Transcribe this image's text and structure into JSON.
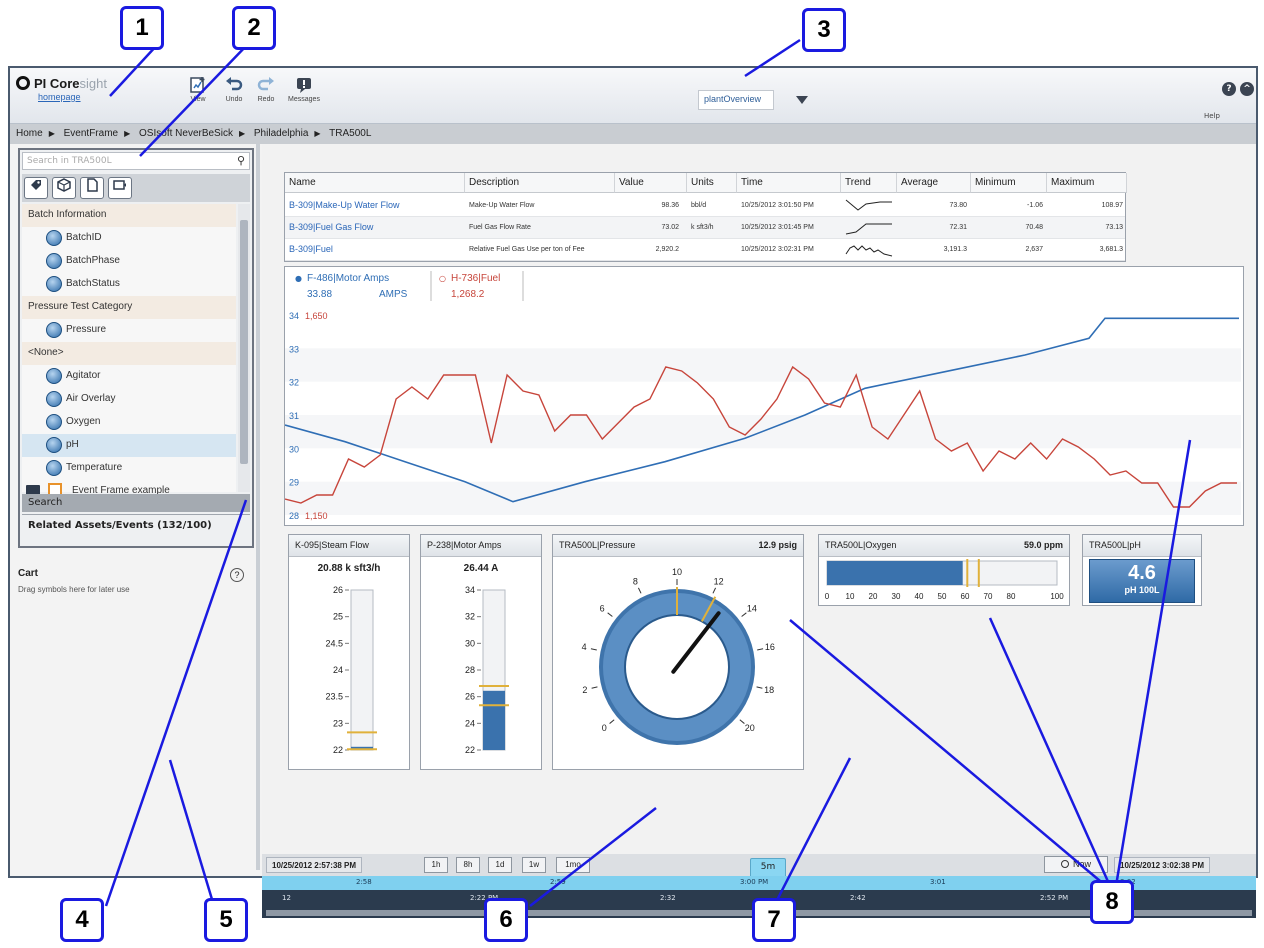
{
  "header": {
    "logo_main": "PI Core",
    "logo_sub": "sight",
    "homepage_link": "homepage",
    "toolbar": [
      {
        "label": "View",
        "icon": "new-display-icon"
      },
      {
        "label": "Undo",
        "icon": "undo-icon"
      },
      {
        "label": "Redo",
        "icon": "redo-icon"
      },
      {
        "label": "Messages",
        "icon": "messages-icon"
      }
    ],
    "display_name": "plantOverview",
    "help_label": "Help",
    "help_glyph": "?",
    "collapse_glyph": "^"
  },
  "breadcrumb": [
    "Home",
    "EventFrame",
    "OSIsoft NeverBeSick",
    "Philadelphia",
    "TRA500L"
  ],
  "search": {
    "placeholder": "Search in TRA500L"
  },
  "tree": {
    "categories": [
      {
        "label": "Batch Information",
        "items": [
          "BatchID",
          "BatchPhase",
          "BatchStatus"
        ]
      },
      {
        "label": "Pressure Test Category",
        "items": [
          "Pressure"
        ]
      },
      {
        "label": "<None>",
        "items": [
          "Agitator",
          "Air Overlay",
          "Oxygen",
          "pH",
          "Temperature"
        ]
      }
    ],
    "selected": "pH",
    "event_frame_label": "Event Frame example"
  },
  "search_section_label": "Search",
  "related_label": "Related Assets/Events (132/100)",
  "cart": {
    "title": "Cart",
    "description": "Drag symbols here for later use",
    "help_glyph": "?"
  },
  "table": {
    "headers": [
      "Name",
      "Description",
      "Value",
      "Units",
      "Time",
      "Trend",
      "Average",
      "Minimum",
      "Maximum"
    ],
    "rows": [
      {
        "name": "B-309|Make-Up Water Flow",
        "description": "Make-Up Water Flow",
        "value": "98.36",
        "units": "bbl/d",
        "time": "10/25/2012 3:01:50 PM",
        "average": "73.80",
        "minimum": "-1.06",
        "maximum": "108.97"
      },
      {
        "name": "B-309|Fuel Gas Flow",
        "description": "Fuel Gas Flow Rate",
        "value": "73.02",
        "units": "k sft3/h",
        "time": "10/25/2012 3:01:45 PM",
        "average": "72.31",
        "minimum": "70.48",
        "maximum": "73.13"
      },
      {
        "name": "B-309|Fuel",
        "description": "Relative Fuel Gas Use per ton of Fee",
        "value": "2,920.2",
        "units": "",
        "time": "10/25/2012 3:02:31 PM",
        "average": "3,191.3",
        "minimum": "2,637",
        "maximum": "3,681.3"
      }
    ]
  },
  "trend": {
    "series": [
      {
        "name": "F-486|Motor Amps",
        "value": "33.88",
        "units": "AMPS",
        "color": "#2f6eb5"
      },
      {
        "name": "H-736|Fuel",
        "value": "1,268.2",
        "units": "",
        "color": "#c7453b"
      }
    ],
    "left_axis_ticks": [
      "34",
      "33",
      "32",
      "31",
      "30",
      "29",
      "28"
    ],
    "right_axis_top": "1,650",
    "right_axis_bottom": "1,150"
  },
  "chart_data": {
    "type": "line",
    "series": [
      {
        "name": "F-486|Motor Amps",
        "values": [
          30.7,
          30.2,
          29.6,
          29.0,
          28.4,
          29.0,
          29.6,
          30.3,
          31.0,
          31.8,
          32.3,
          32.8,
          33.3,
          33.9,
          33.9,
          33.9,
          33.9
        ]
      },
      {
        "name": "H-736|Fuel",
        "values": [
          1190,
          1180,
          1200,
          1200,
          1290,
          1270,
          1300,
          1440,
          1470,
          1440,
          1500,
          1500,
          1500,
          1330,
          1500,
          1460,
          1450,
          1360,
          1400,
          1400,
          1340,
          1380,
          1420,
          1440,
          1520,
          1510,
          1480,
          1440,
          1370,
          1350,
          1390,
          1440,
          1520,
          1490,
          1430,
          1420,
          1500,
          1370,
          1340,
          1400,
          1460,
          1340,
          1310,
          1330,
          1260,
          1310,
          1290,
          1330,
          1290,
          1340,
          1320,
          1290,
          1250,
          1260,
          1230,
          1230,
          1170,
          1170,
          1210,
          1230,
          1230
        ]
      }
    ],
    "ylim_left": [
      28,
      34
    ],
    "ylim_right": [
      1150,
      1650
    ]
  },
  "symbols": {
    "steam": {
      "title": "K-095|Steam Flow",
      "value": "20.88 k sft3/h",
      "ticks": [
        "26",
        "25",
        "24.5",
        "24",
        "23.5",
        "23",
        "22"
      ],
      "fill_fraction": 0.02
    },
    "amps": {
      "title": "P-238|Motor Amps",
      "value": "26.44 A",
      "ticks": [
        "34",
        "32",
        "30",
        "28",
        "26",
        "24",
        "22"
      ],
      "fill_fraction": 0.37
    },
    "pressure": {
      "title": "TRA500L|Pressure",
      "value": "12.9 psig",
      "ticks": [
        "0",
        "2",
        "4",
        "6",
        "8",
        "10",
        "12",
        "14",
        "16",
        "18",
        "20"
      ],
      "gauge_value": 12.9,
      "gauge_max": 20
    },
    "oxygen": {
      "title": "TRA500L|Oxygen",
      "value": "59.0 ppm",
      "ticks": [
        "0",
        "10",
        "20",
        "30",
        "40",
        "50",
        "60",
        "70",
        "80",
        "100"
      ],
      "fill_fraction": 0.59
    },
    "ph": {
      "title": "TRA500L|pH",
      "value": "4.6",
      "sub": "pH 100L"
    }
  },
  "timebar": {
    "start": "10/25/2012 2:57:38 PM",
    "end": "10/25/2012 3:02:38 PM",
    "ranges": [
      "1h",
      "8h",
      "1d",
      "1w",
      "1mo"
    ],
    "current_range": "5m",
    "now_label": "Now",
    "upper_ticks": [
      "2:58",
      "2:59",
      "3:00 PM",
      "3:01",
      "3:02"
    ],
    "lower_ticks": [
      "12",
      "2:22 PM",
      "2:32",
      "2:42",
      "2:52 PM"
    ]
  },
  "callouts": [
    "1",
    "2",
    "3",
    "4",
    "5",
    "6",
    "7",
    "8"
  ]
}
